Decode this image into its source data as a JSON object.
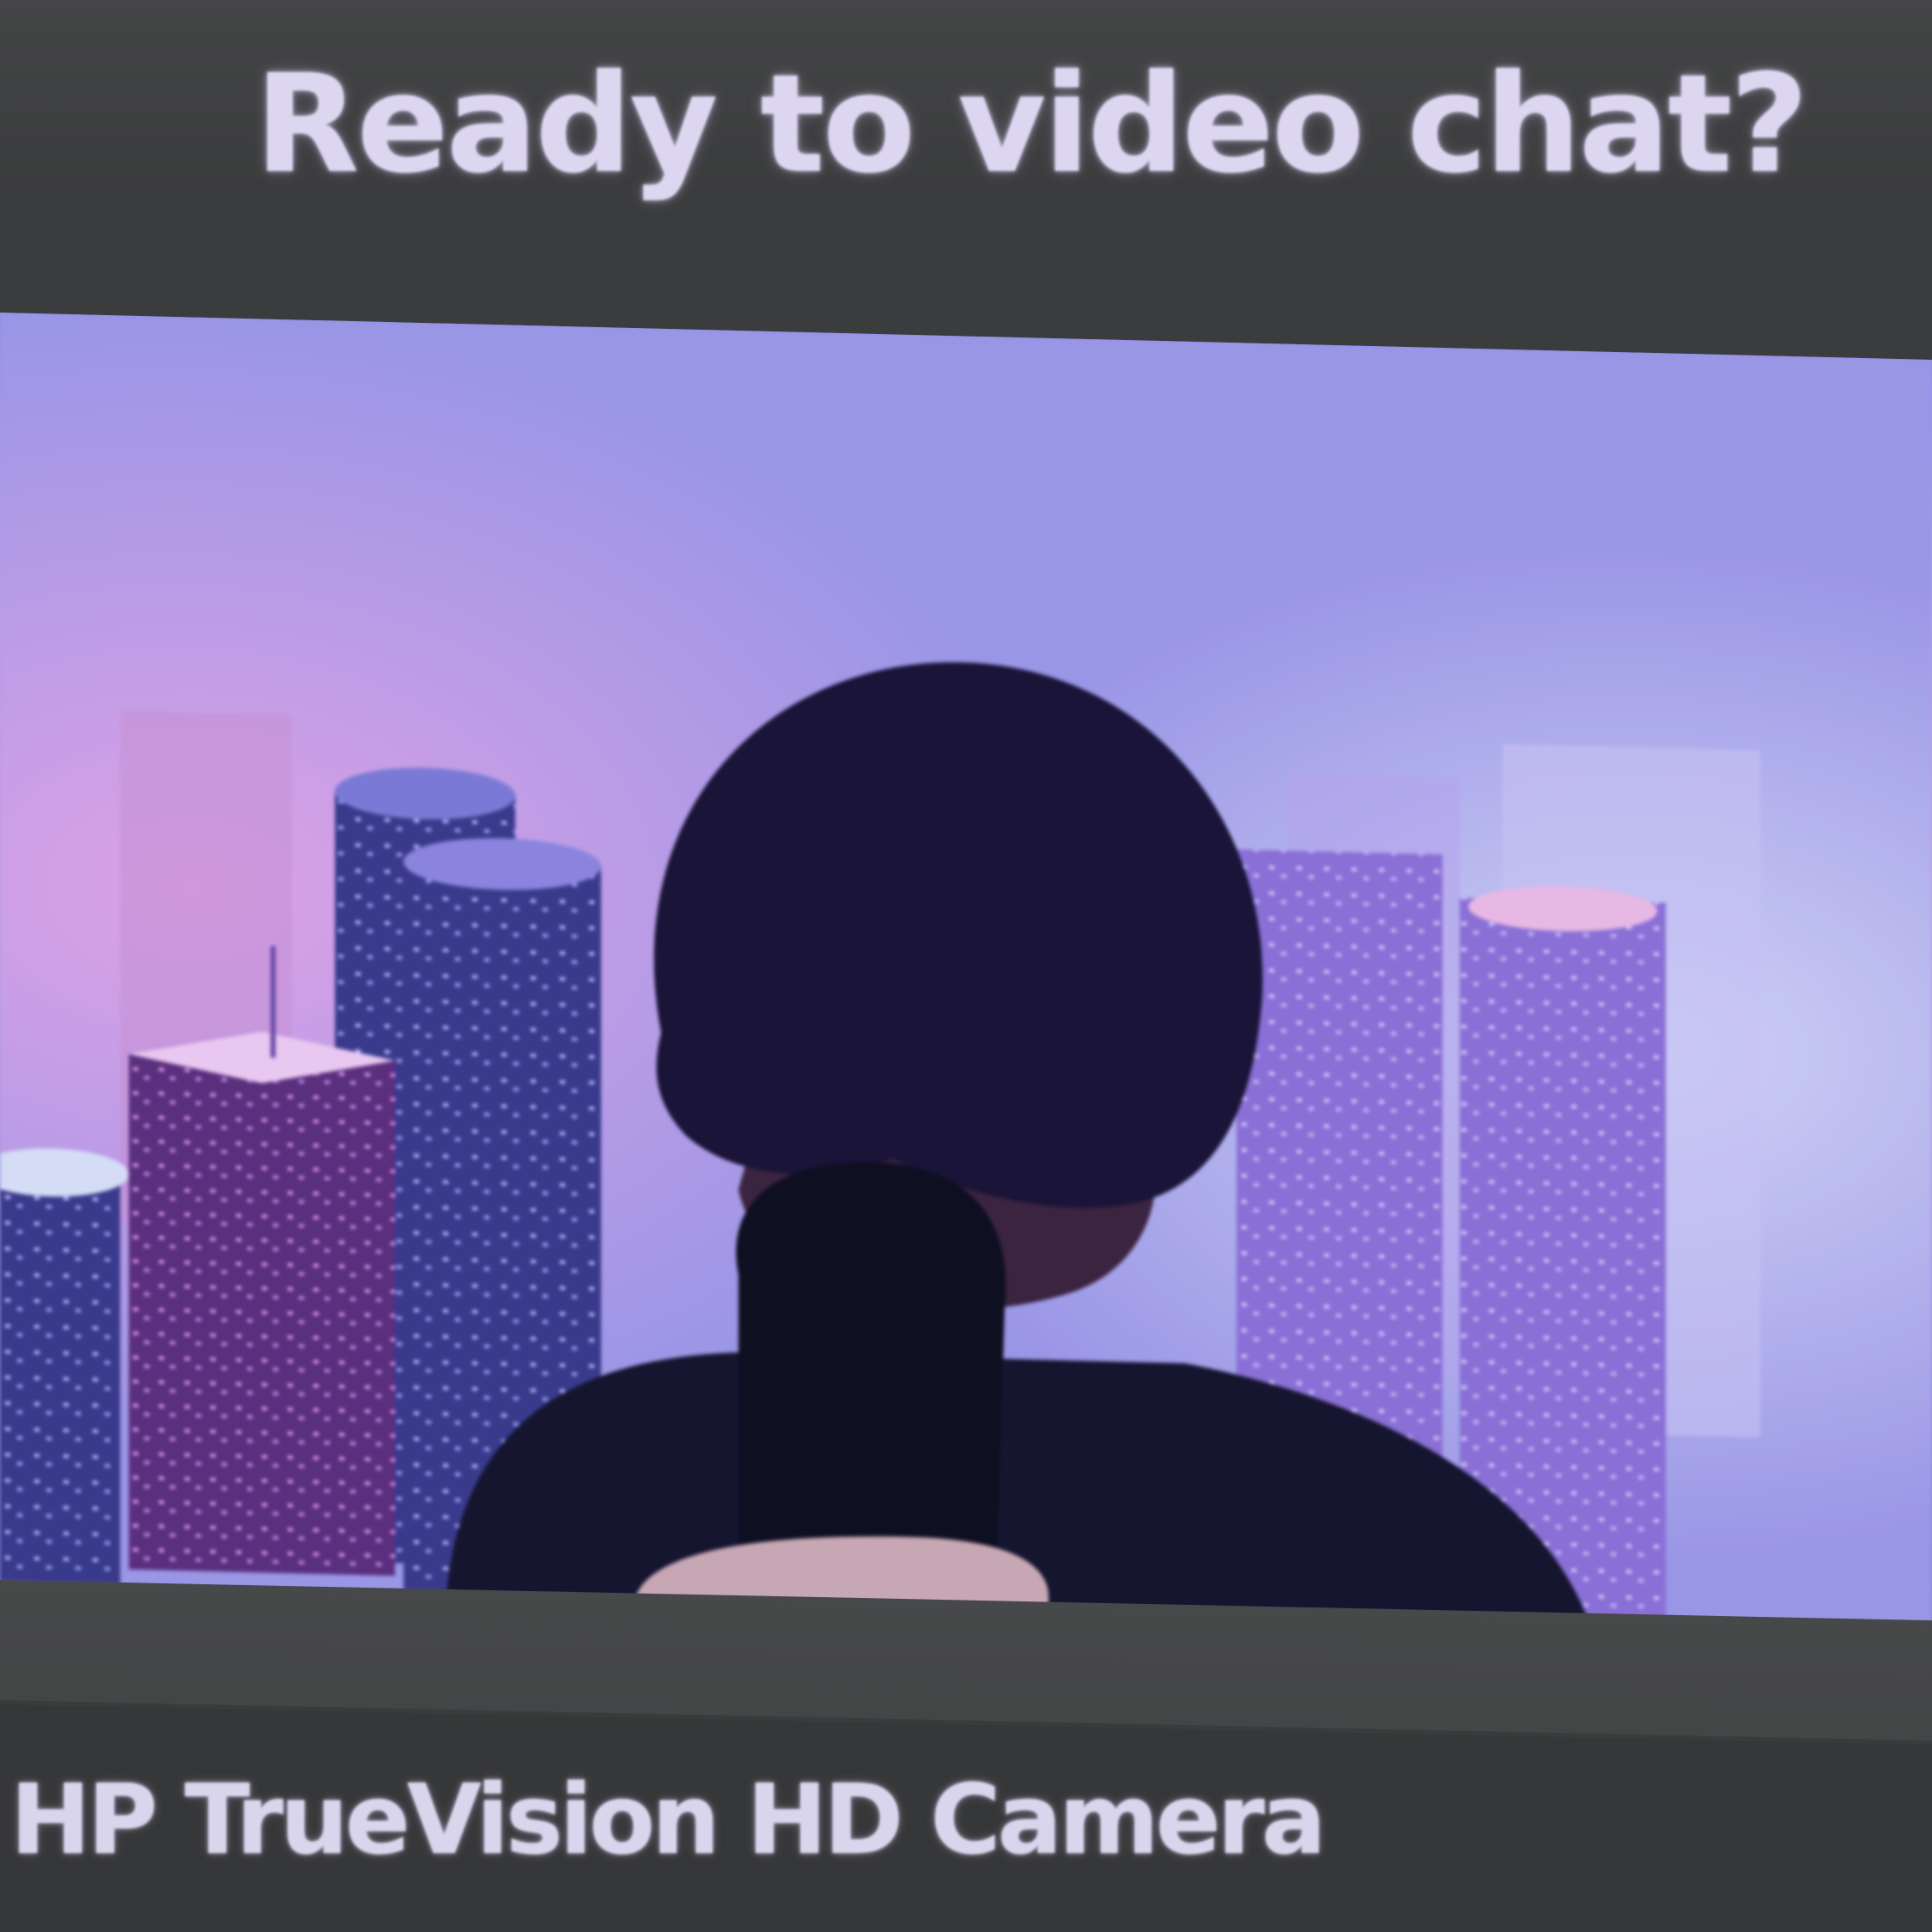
{
  "prompt": {
    "title": "Ready to video chat?"
  },
  "camera_preview": {
    "description_icon": "webcam-feed"
  },
  "device": {
    "camera_name": "HP TrueVision HD Camera"
  },
  "colors": {
    "background": "#3c3d3e",
    "text": "#dcd6f0",
    "preview_tint": "#a898de"
  }
}
